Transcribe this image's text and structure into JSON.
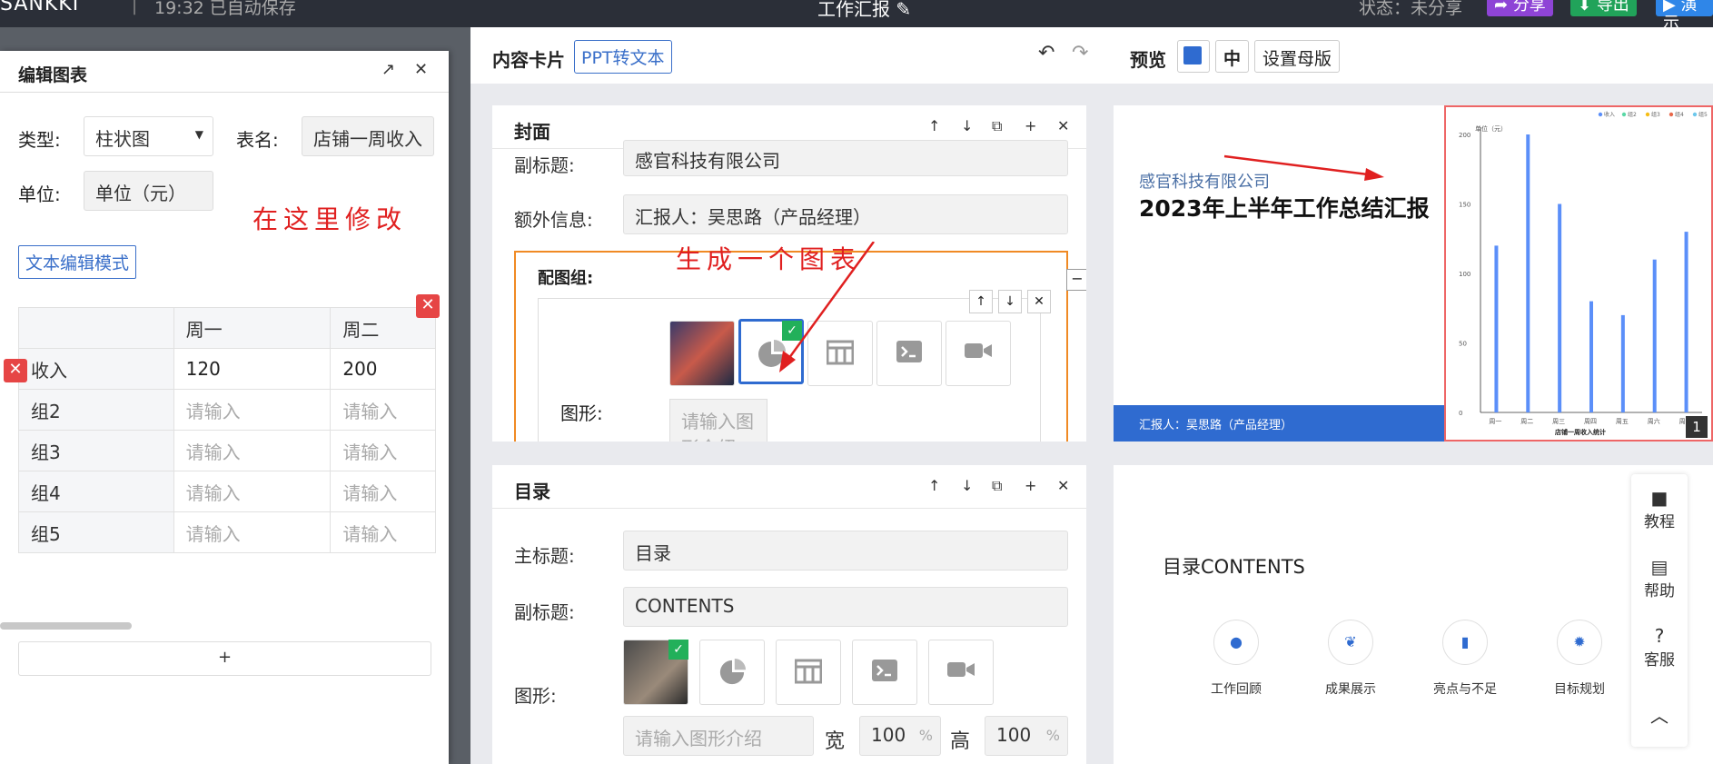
{
  "topbar": {
    "logo": "SANKKI",
    "autosave": "19:32 已自动保存",
    "title": "工作汇报",
    "status": "状态：未分享",
    "share_label": "分享",
    "export_label": "导出",
    "present_label": "演示",
    "colors": {
      "share": "#8e44d6",
      "export": "#21a35a",
      "present": "#2f86e8"
    }
  },
  "modal": {
    "title": "编辑图表",
    "type_label": "类型:",
    "type_value": "柱状图",
    "name_label": "表名:",
    "name_value": "店铺一周收入",
    "unit_label": "单位:",
    "unit_value": "单位（元）",
    "text_mode_btn": "文本编辑模式",
    "annotation": "在这里修改",
    "table": {
      "headers": [
        "",
        "周一",
        "周二"
      ],
      "rows": [
        [
          "收入",
          "120",
          "200"
        ],
        [
          "组2",
          "请输入",
          "请输入"
        ],
        [
          "组3",
          "请输入",
          "请输入"
        ],
        [
          "组4",
          "请输入",
          "请输入"
        ],
        [
          "组5",
          "请输入",
          "请输入"
        ]
      ]
    },
    "add_label": "+"
  },
  "editor": {
    "content_card_label": "内容卡片",
    "ppt_to_text": "PPT转文本",
    "preview_label": "预览",
    "mid_label": "中",
    "master_label": "设置母版"
  },
  "cover_card": {
    "title": "封面",
    "subtitle_label": "副标题:",
    "subtitle_value": "感官科技有限公司",
    "extra_label": "额外信息:",
    "extra_value": "汇报人：吴思路（产品经理）",
    "group_label": "配图组:",
    "annotation": "生成一个图表",
    "shape_label": "图形:",
    "shape_desc_placeholder": "请输入图形介绍"
  },
  "toc_card": {
    "title": "目录",
    "main_title_label": "主标题:",
    "main_title_value": "目录",
    "subtitle_label": "副标题:",
    "subtitle_value": "CONTENTS",
    "shape_label": "图形:",
    "desc_placeholder": "请输入图形介绍",
    "width_label": "宽",
    "width_value": "100",
    "height_label": "高",
    "height_value": "100",
    "percent": "%"
  },
  "preview_slide1": {
    "company": "感官科技有限公司",
    "title": "2023年上半年工作总结汇报",
    "footer": "汇报人：吴思路（产品经理）",
    "page": "1",
    "chart_unit": "单位（元）",
    "chart_title": "店铺一周收入统计"
  },
  "chart_data": {
    "type": "bar",
    "title": "店铺一周收入统计",
    "ylabel": "单位（元）",
    "categories": [
      "周一",
      "周二",
      "周三",
      "周四",
      "周五",
      "周六",
      "周日"
    ],
    "series": [
      {
        "name": "收入",
        "values": [
          120,
          200,
          150,
          80,
          70,
          110,
          130
        ]
      }
    ],
    "yticks": [
      "0",
      "50",
      "100",
      "150",
      "200"
    ],
    "ylim": [
      0,
      200
    ],
    "legend": [
      "收入",
      "组2",
      "组3",
      "组4",
      "组5"
    ],
    "legend_colors": [
      "#5b8ff9",
      "#5ad8a6",
      "#f6bd16",
      "#e8684a",
      "#6dc8ec"
    ],
    "bar_color": "#5b8ff9"
  },
  "preview_slide2": {
    "title": "目录CONTENTS",
    "items": [
      "工作回顾",
      "成果展示",
      "亮点与不足",
      "目标规划"
    ]
  },
  "float_menu": {
    "items": [
      "教程",
      "帮助",
      "客服"
    ]
  }
}
